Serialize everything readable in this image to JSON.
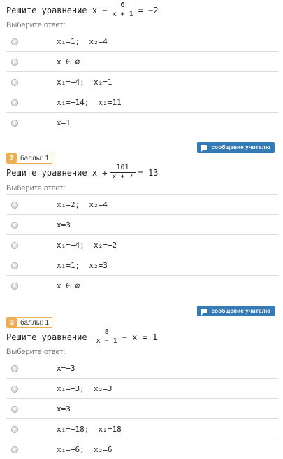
{
  "questions": [
    {
      "number": "",
      "points": "",
      "title_prefix": "Решите уравнение x −",
      "frac_num": "6",
      "frac_den": "x + 1",
      "title_suffix": "= −2",
      "prompt": "Выберите ответ:",
      "options": [
        "x₁=1;  x₂=4",
        "x ∈ ∅",
        "x₁=−4;  x₂=1",
        "x₁=−14;  x₂=11",
        "x=1"
      ],
      "message_button": "сообщение учителю"
    },
    {
      "number": "2",
      "points": "баллы: 1",
      "title_prefix": "Решите уравнение x +",
      "frac_num": "101",
      "frac_den": "x + 7",
      "title_suffix": "= 13",
      "prompt": "Выберите ответ:",
      "options": [
        "x₁=2;  x₂=4",
        "x=3",
        "x₁=−4;  x₂=−2",
        "x₁=1;  x₂=3",
        "x ∈ ∅"
      ],
      "message_button": "сообщение учителю"
    },
    {
      "number": "3",
      "points": "баллы: 1",
      "title_prefix": "Решите уравнение",
      "frac_num": "8",
      "frac_den": "x − 1",
      "title_suffix": "− x = 1",
      "prompt": "Выберите ответ:",
      "options": [
        "x=−3",
        "x₁=−3;  x₂=3",
        "x=3",
        "x₁=−18;  x₂=18",
        "x₁=−6;  x₂=6"
      ]
    }
  ],
  "colors": {
    "badge": "#f0ad4e",
    "button": "#337ab7",
    "divider": "#dcdcdc"
  },
  "icons": {
    "radio": "radio-button",
    "message": "chat-icon"
  }
}
